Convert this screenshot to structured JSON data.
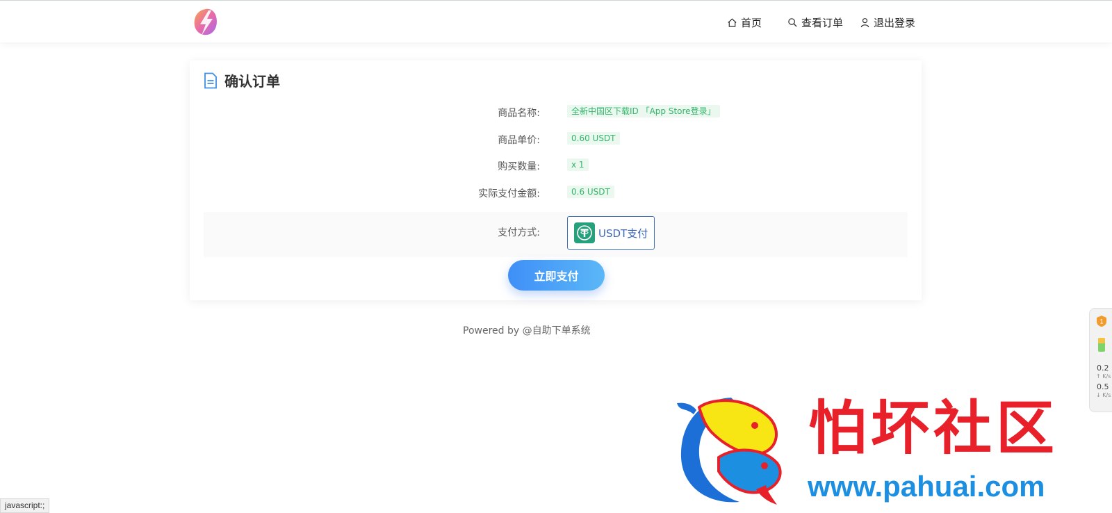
{
  "nav": {
    "home": "首页",
    "orders": "查看订单",
    "logout": "退出登录"
  },
  "card": {
    "title": "确认订单",
    "rows": [
      {
        "label": "商品名称:",
        "value": "全新中国区下载ID 「App Store登录」"
      },
      {
        "label": "商品单价:",
        "value": "0.60 USDT"
      },
      {
        "label": "购买数量:",
        "value": "x 1"
      },
      {
        "label": "实际支付金额:",
        "value": "0.6 USDT"
      }
    ],
    "payment_label": "支付方式:",
    "payment_option": "USDT支付",
    "pay_button": "立即支付"
  },
  "footer": "Powered by @自助下单系统",
  "side_widget": {
    "upload_value": "0.2",
    "upload_unit": "K/s",
    "download_value": "0.5",
    "download_unit": "K/s"
  },
  "watermark": {
    "title": "怕坏社区",
    "url": "www.pahuai.com"
  },
  "status_bar": "javascript:;",
  "colors": {
    "tag_bg": "#eaf8ef",
    "tag_text": "#33b56a",
    "button_start": "#3f8ff7",
    "button_end": "#5bb7f7",
    "payment_border": "#3d6fb8",
    "watermark_red": "#e8202a",
    "watermark_blue": "#1c8fe0"
  }
}
